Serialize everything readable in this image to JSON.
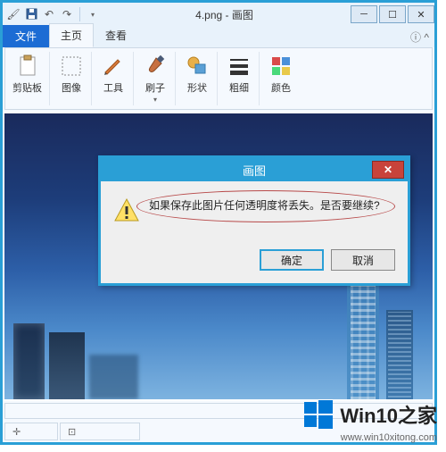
{
  "window": {
    "title": "4.png - 画图",
    "qat_icons": [
      "save-icon",
      "undo-icon",
      "redo-icon"
    ]
  },
  "tabs": {
    "file": "文件",
    "home": "主页",
    "view": "查看"
  },
  "ribbon": {
    "clipboard": "剪贴板",
    "image": "图像",
    "tools": "工具",
    "brushes": "刷子",
    "shapes": "形状",
    "stroke": "粗细",
    "colors": "颜色"
  },
  "dialog": {
    "title": "画图",
    "message": "如果保存此图片任何透明度将丢失。是否要继续?",
    "ok": "确定",
    "cancel": "取消"
  },
  "watermark": {
    "label": "Win10之家",
    "url": "www.win10xitong.com"
  }
}
